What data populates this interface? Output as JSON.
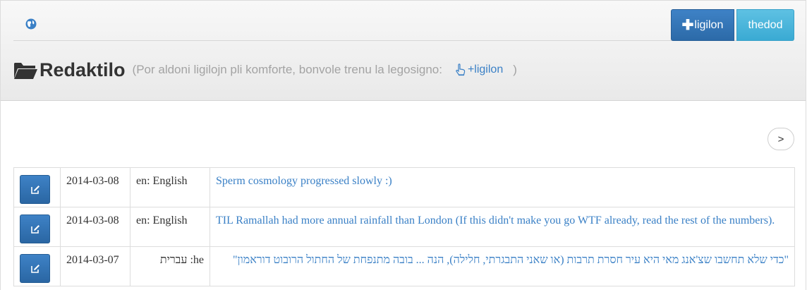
{
  "header": {
    "globe_icon": "globe-icon",
    "login_button": {
      "icon": "plus-icon",
      "label": "ligilon"
    },
    "user_button": {
      "label": "thedod"
    },
    "title": "Redaktilo",
    "subtitle_prefix": "(Por aldoni ligilojn pli komforte, bonvole trenu la legosigno:",
    "subtitle_link": "+ligilon",
    "subtitle_suffix": ")",
    "colors": {
      "primary": "#3a80c6",
      "info": "#49b6dc",
      "muted": "#a3a3a3"
    }
  },
  "pager": {
    "next_label": ">"
  },
  "entries": [
    {
      "date": "2014-03-08",
      "lang": "en: English",
      "text": "Sperm cosmology progressed slowly :)"
    },
    {
      "date": "2014-03-08",
      "lang": "en: English",
      "text": "TIL Ramallah had more annual rainfall than London (If this didn't make you go WTF already, read the rest of the numbers)."
    },
    {
      "date": "2014-03-07",
      "lang": "he: עברית",
      "text": "\"כדי שלא תחשבו שצ'אנג מאי היא עיר חסרת תרבות (או שאני התבגרתי, חלילה), הנה ... בובה מתנפחת של החתול הרובוט דוראמון\""
    }
  ]
}
